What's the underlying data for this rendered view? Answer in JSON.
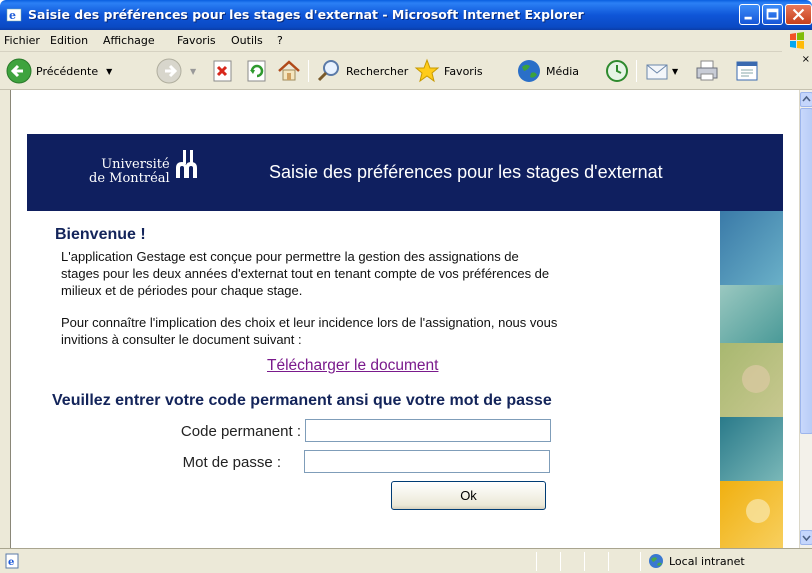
{
  "window": {
    "title": "Saisie des préférences pour les stages d'externat - Microsoft Internet Explorer"
  },
  "menubar": {
    "items": [
      "Fichier",
      "Edition",
      "Affichage",
      "Favoris",
      "Outils",
      "?"
    ]
  },
  "toolbar": {
    "back_label": "Précédente",
    "search_label": "Rechercher",
    "favorites_label": "Favoris",
    "media_label": "Média"
  },
  "banner": {
    "logo_line1": "Université",
    "logo_line2": "de Montréal",
    "title": "Saisie des préférences pour les stages d'externat",
    "background": "#0f1f5f"
  },
  "content": {
    "welcome": "Bienvenue !",
    "para1_line1": "L'application Gestage est conçue pour permettre la gestion des assignations de",
    "para1_line2": "stages pour les deux années d'externat tout en tenant compte de vos préférences de",
    "para1_line3": "milieux et de périodes pour chaque stage.",
    "para2_line1": "Pour connaître l'implication des choix et leur incidence lors de l'assignation, nous vous",
    "para2_line2": "invitions à consulter le document suivant :",
    "download_link": "Télécharger le document",
    "prompt": "Veuillez entrer votre code permanent ansi que votre mot de passe",
    "code_label": "Code permanent :",
    "code_value": "",
    "password_label": "Mot de passe :",
    "password_value": "",
    "ok_label": "Ok"
  },
  "statusbar": {
    "zone": "Local intranet"
  },
  "colors": {
    "heading": "#13245a",
    "link_visited": "#7a1a8c",
    "xp_blue": "#0a4ac4"
  }
}
